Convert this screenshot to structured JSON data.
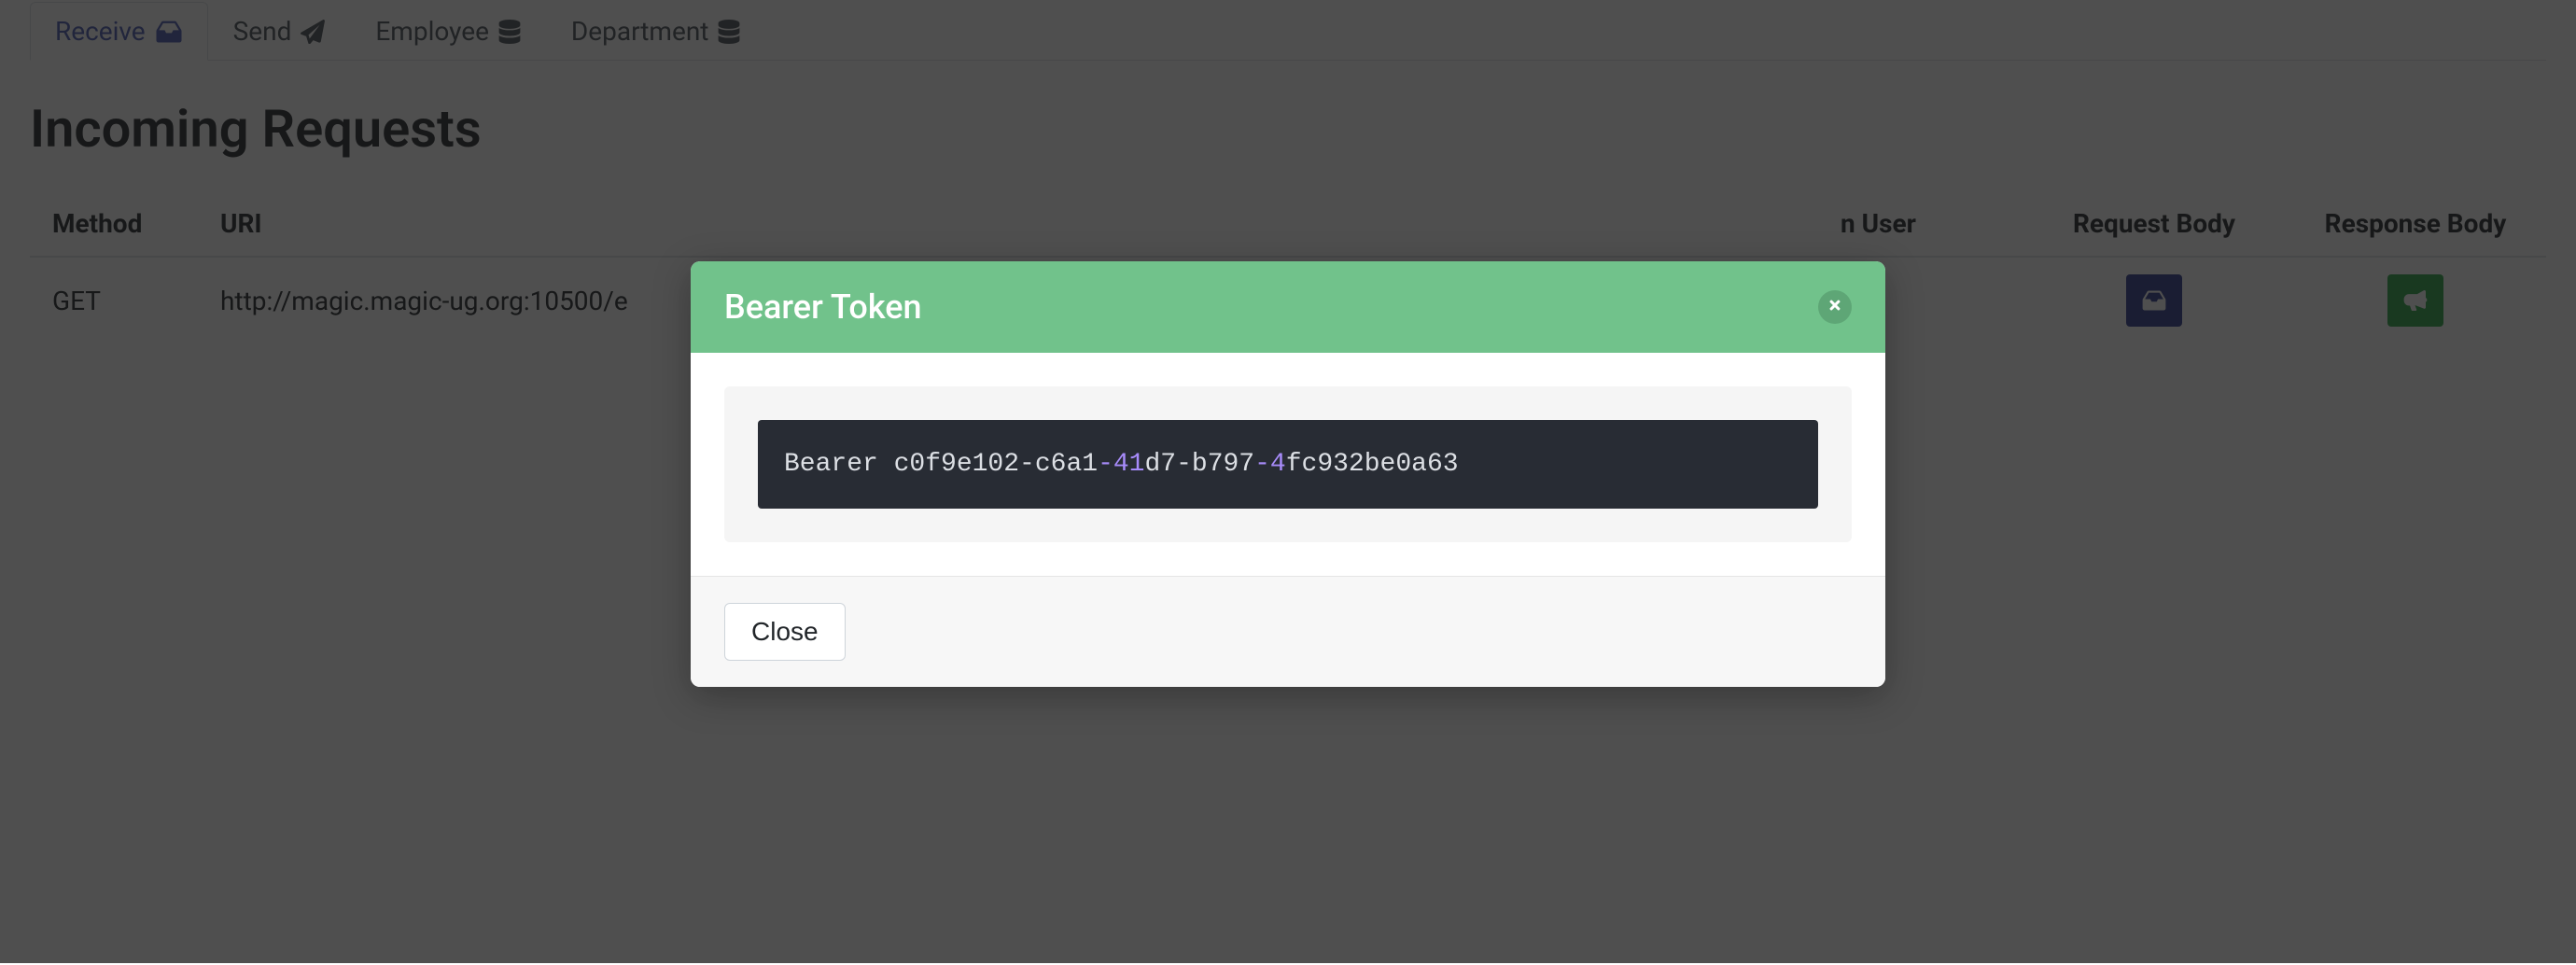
{
  "nav": {
    "tabs": [
      {
        "label": "Receive",
        "icon": "inbox-icon",
        "active": true
      },
      {
        "label": "Send",
        "icon": "paper-plane-icon",
        "active": false
      },
      {
        "label": "Employee",
        "icon": "database-icon",
        "active": false
      },
      {
        "label": "Department",
        "icon": "database-icon",
        "active": false
      }
    ]
  },
  "page": {
    "title": "Incoming Requests"
  },
  "table": {
    "headers": {
      "method": "Method",
      "uri": "URI",
      "login_user": "n User",
      "request_body": "Request Body",
      "response_body": "Response Body"
    },
    "rows": [
      {
        "method": "GET",
        "uri": "http://magic.magic-ug.org:10500/e"
      }
    ]
  },
  "modal": {
    "title": "Bearer Token",
    "token": {
      "p1": "Bearer c0f9e102-c6a1",
      "p2": "-41",
      "p3": "d7-b797",
      "p4": "-4",
      "p5": "fc932be0a63"
    },
    "close_label": "Close"
  },
  "colors": {
    "tab_active": "#4759b2",
    "modal_header": "#71c28b",
    "code_bg": "#282c34",
    "highlight": "#a78bfa",
    "btn_blue": "#2f3a8f",
    "btn_green": "#28a745"
  }
}
